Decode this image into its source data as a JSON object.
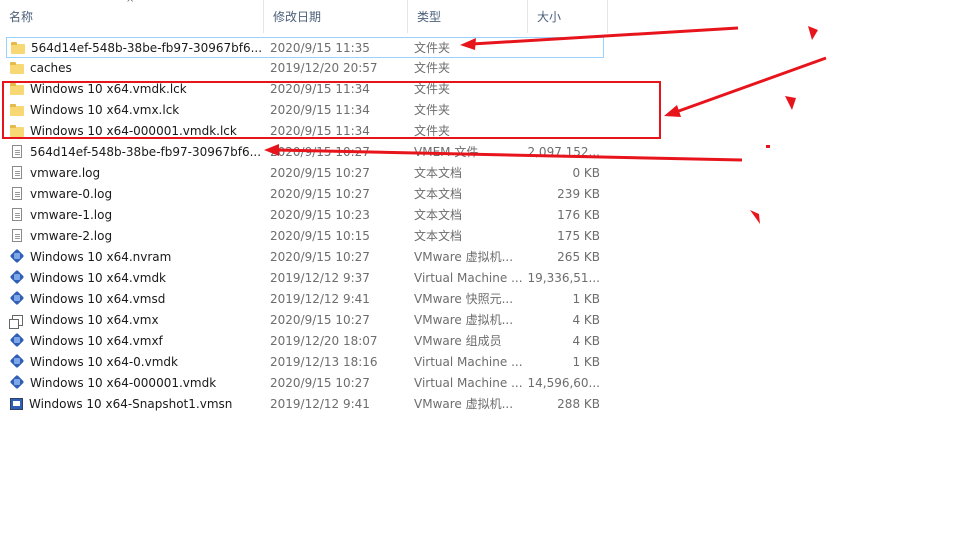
{
  "header": {
    "col_name": "名称",
    "col_date": "修改日期",
    "col_type": "类型",
    "col_size": "大小",
    "sort_arrow": "^"
  },
  "files": [
    {
      "name": "564d14ef-548b-38be-fb97-30967bf6...",
      "date": "2020/9/15 11:35",
      "type": "文件夹",
      "size": "",
      "icon": "folder-icon"
    },
    {
      "name": "caches",
      "date": "2019/12/20 20:57",
      "type": "文件夹",
      "size": "",
      "icon": "folder-icon"
    },
    {
      "name": "Windows 10 x64.vmdk.lck",
      "date": "2020/9/15 11:34",
      "type": "文件夹",
      "size": "",
      "icon": "folder-icon"
    },
    {
      "name": "Windows 10 x64.vmx.lck",
      "date": "2020/9/15 11:34",
      "type": "文件夹",
      "size": "",
      "icon": "folder-icon"
    },
    {
      "name": "Windows 10 x64-000001.vmdk.lck",
      "date": "2020/9/15 11:34",
      "type": "文件夹",
      "size": "",
      "icon": "folder-icon"
    },
    {
      "name": "564d14ef-548b-38be-fb97-30967bf6...",
      "date": "2020/9/15 10:27",
      "type": "VMEM 文件",
      "size": "2,097,152...",
      "icon": "doc-icon"
    },
    {
      "name": "vmware.log",
      "date": "2020/9/15 10:27",
      "type": "文本文档",
      "size": "0 KB",
      "icon": "doc-icon"
    },
    {
      "name": "vmware-0.log",
      "date": "2020/9/15 10:27",
      "type": "文本文档",
      "size": "239 KB",
      "icon": "doc-icon"
    },
    {
      "name": "vmware-1.log",
      "date": "2020/9/15 10:23",
      "type": "文本文档",
      "size": "176 KB",
      "icon": "doc-icon"
    },
    {
      "name": "vmware-2.log",
      "date": "2020/9/15 10:15",
      "type": "文本文档",
      "size": "175 KB",
      "icon": "doc-icon"
    },
    {
      "name": "Windows 10 x64.nvram",
      "date": "2020/9/15 10:27",
      "type": "VMware 虚拟机...",
      "size": "265 KB",
      "icon": "cube-icon"
    },
    {
      "name": "Windows 10 x64.vmdk",
      "date": "2019/12/12 9:37",
      "type": "Virtual Machine ...",
      "size": "19,336,51...",
      "icon": "cube-icon"
    },
    {
      "name": "Windows 10 x64.vmsd",
      "date": "2019/12/12 9:41",
      "type": "VMware 快照元...",
      "size": "1 KB",
      "icon": "cube-icon"
    },
    {
      "name": "Windows 10 x64.vmx",
      "date": "2020/9/15 10:27",
      "type": "VMware 虚拟机...",
      "size": "4 KB",
      "icon": "vmx-icon"
    },
    {
      "name": "Windows 10 x64.vmxf",
      "date": "2019/12/20 18:07",
      "type": "VMware 组成员",
      "size": "4 KB",
      "icon": "cube-icon"
    },
    {
      "name": "Windows 10 x64-0.vmdk",
      "date": "2019/12/13 18:16",
      "type": "Virtual Machine ...",
      "size": "1 KB",
      "icon": "cube-icon"
    },
    {
      "name": "Windows 10 x64-000001.vmdk",
      "date": "2020/9/15 10:27",
      "type": "Virtual Machine ...",
      "size": "14,596,60...",
      "icon": "cube-icon"
    },
    {
      "name": "Windows 10 x64-Snapshot1.vmsn",
      "date": "2019/12/12 9:41",
      "type": "VMware 虚拟机...",
      "size": "288 KB",
      "icon": "snap-icon"
    }
  ],
  "annotation_color": "#e8141c",
  "selection_border_color": "#99d1ff"
}
